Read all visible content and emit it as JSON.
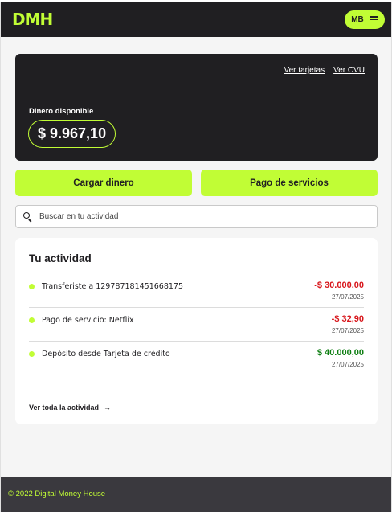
{
  "header": {
    "logo_text": "DMH",
    "user_initials": "MB",
    "menu_icon": "hamburger-menu-icon"
  },
  "balance_card": {
    "links": [
      "Ver tarjetas",
      "Ver CVU"
    ],
    "label": "Dinero disponible",
    "amount": "$ 9.967,10"
  },
  "actions": {
    "load_money": "Cargar dinero",
    "pay_services": "Pago de servicios"
  },
  "search": {
    "placeholder": "Buscar en tu actividad",
    "icon": "search-icon"
  },
  "activity": {
    "title": "Tu actividad",
    "items": [
      {
        "description": "Transferiste a 129787181451668175",
        "amount": "-$ 30.000,00",
        "date": "27/07/2025",
        "type": "negative"
      },
      {
        "description": "Pago de servicio: Netflix",
        "amount": "-$ 32,90",
        "date": "27/07/2025",
        "type": "negative"
      },
      {
        "description": "Depósito desde Tarjeta de crédito",
        "amount": "$ 40.000,00",
        "date": "27/07/2025",
        "type": "positive"
      }
    ],
    "view_all": "Ver toda la actividad"
  },
  "footer": {
    "text": "© 2022 Digital Money House"
  },
  "colors": {
    "accent": "#c1fd35",
    "dark": "#201f22",
    "negative": "#d8171c",
    "positive": "#0e7e12"
  }
}
